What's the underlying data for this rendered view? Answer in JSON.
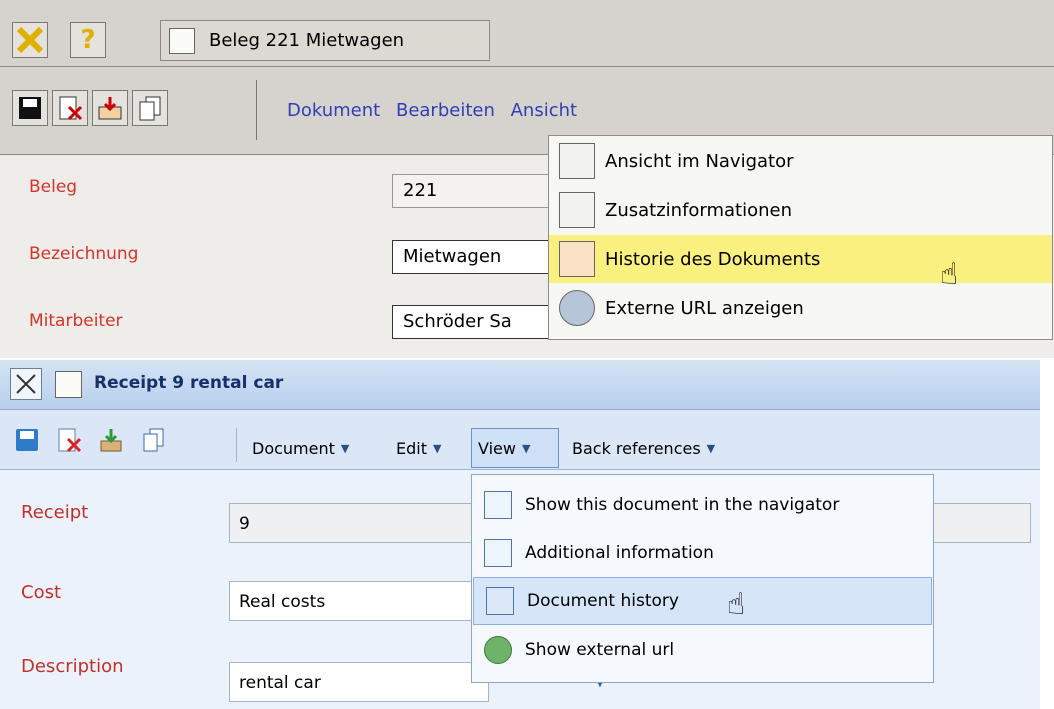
{
  "old_ui": {
    "tab_title": "Beleg 221 Mietwagen",
    "menu": [
      "Dokument",
      "Bearbeiten",
      "Ansicht"
    ],
    "labels": [
      "Beleg",
      "Bezeichnung",
      "Mitarbeiter"
    ],
    "fields": [
      "221",
      "Mietwagen",
      "Schröder Sa"
    ],
    "dropdown": [
      "Ansicht im Navigator",
      "Zusatzinformationen",
      "Historie des Dokuments",
      "Externe URL anzeigen"
    ]
  },
  "new_ui": {
    "title": "Receipt 9 rental car",
    "menu": [
      "Document",
      "Edit",
      "View",
      "Back references"
    ],
    "labels": [
      "Receipt",
      "Cost",
      "Description"
    ],
    "fields": [
      "9",
      "Real costs",
      "rental car"
    ],
    "dropdown": [
      "Show this document in the navigator",
      "Additional information",
      "Document history",
      "Show external url"
    ]
  },
  "colors": {
    "label_red": "#d5332a",
    "menu_blue": "#2f3fb4",
    "highlight_yellow": "#faf080",
    "highlight_blue": "#d6e5f8"
  }
}
